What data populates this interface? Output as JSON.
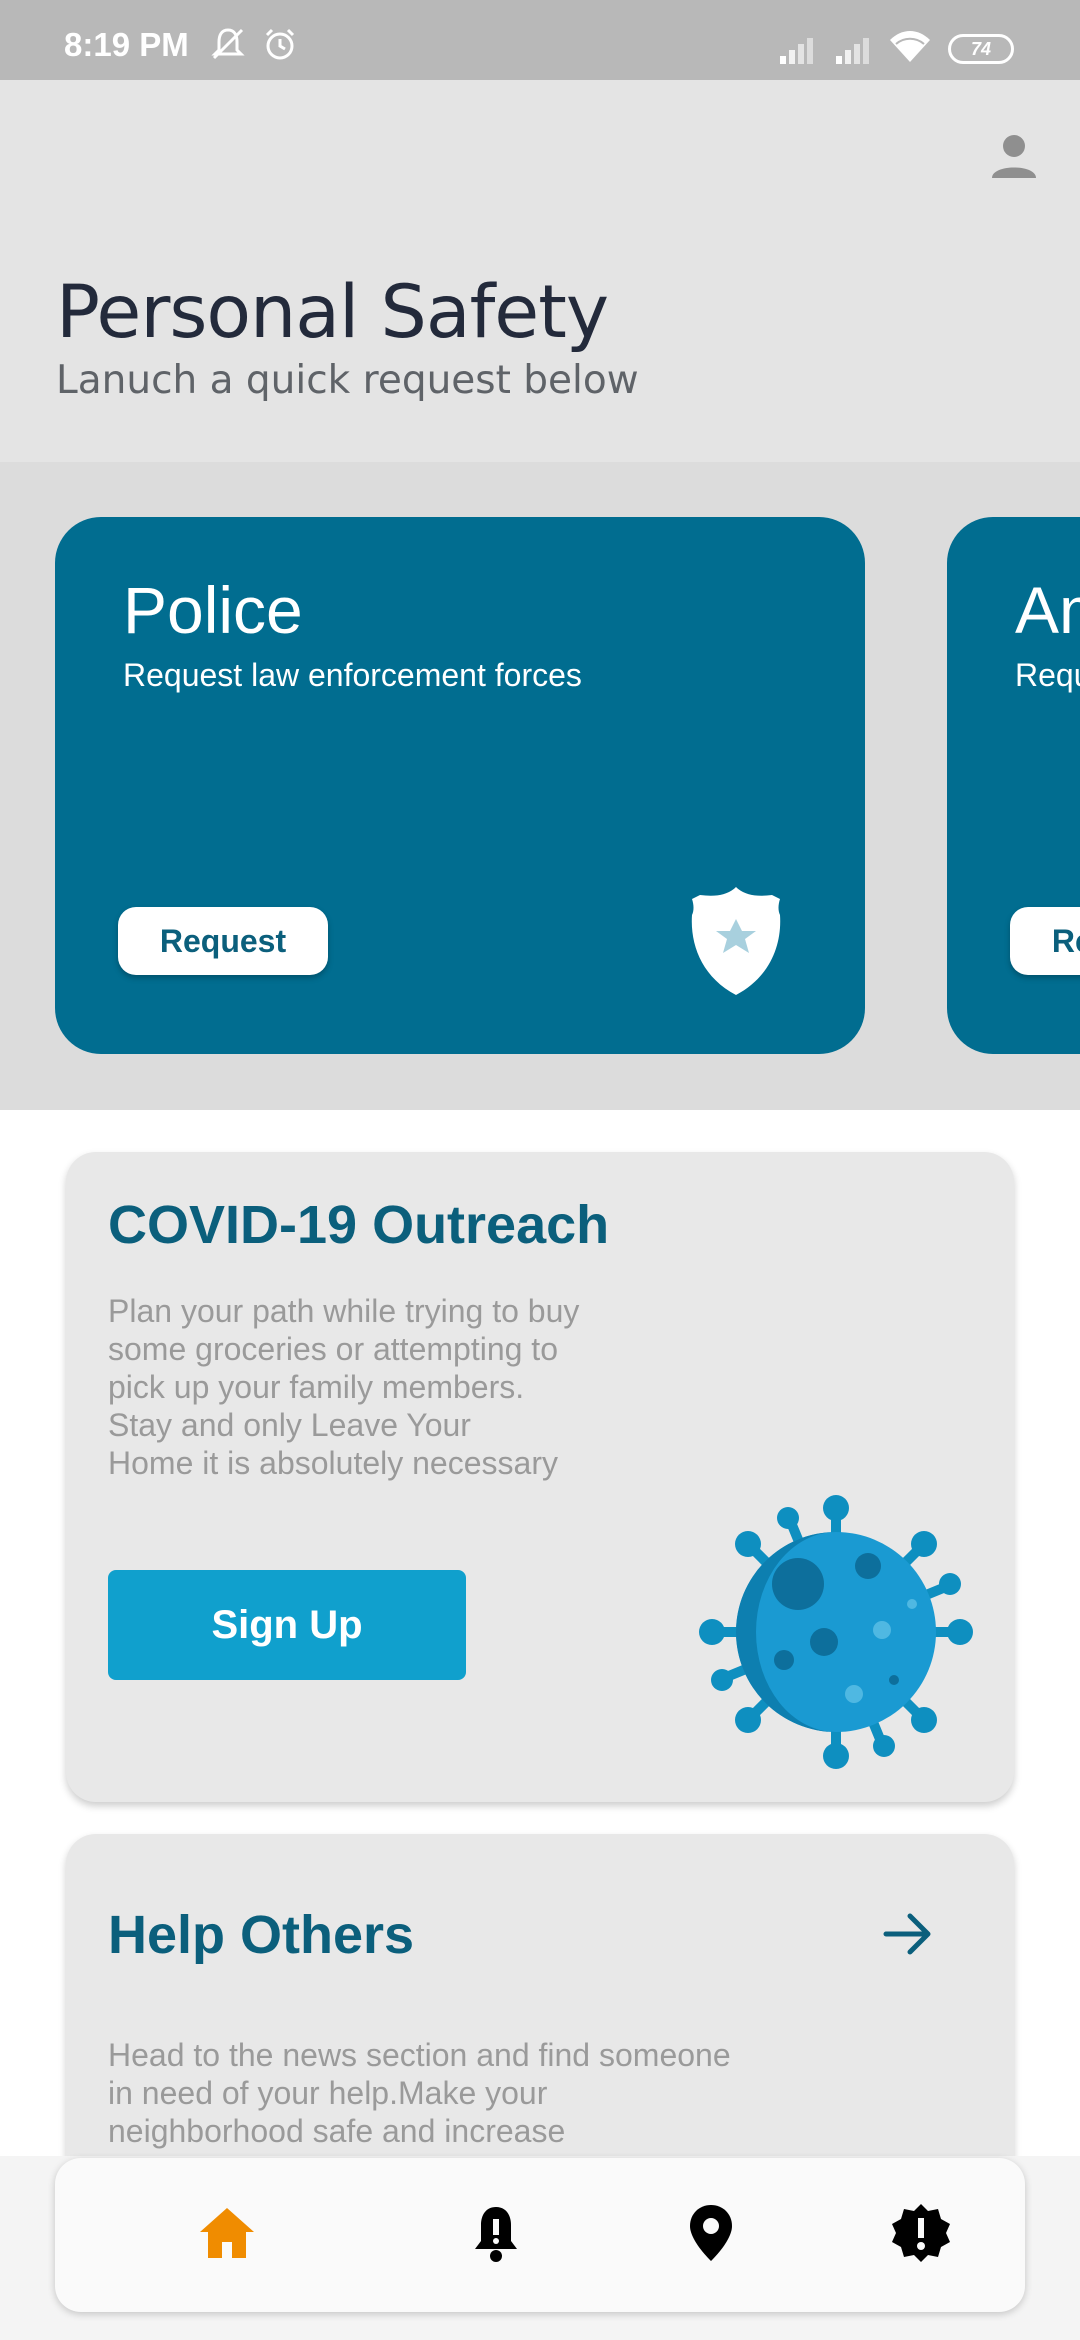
{
  "status_bar": {
    "time": "8:19 PM",
    "battery": "74"
  },
  "header": {
    "title": "Personal Safety",
    "subtitle": "Lanuch a quick request below"
  },
  "services": [
    {
      "title": "Police",
      "description": "Request law enforcement forces",
      "button": "Request",
      "icon": "police-badge-icon"
    },
    {
      "title": "Ambulance",
      "description": "Request medical assistance",
      "button": "Request",
      "icon": "ambulance-icon"
    }
  ],
  "covid": {
    "title": "COVID-19 Outreach",
    "text": "Plan your path while trying to buy\n some groceries or attempting to\n pick up your family members.\n Stay and only Leave Your\n Home it is absolutely necessary",
    "button": "Sign Up",
    "icon": "virus-icon"
  },
  "help": {
    "title": "Help Others",
    "text": "Head to the news section and find someone\nin need of your help.Make your\n neighborhood safe and increase",
    "icon": "arrow-right-icon"
  },
  "nav": {
    "items": [
      "home-icon",
      "bell-icon",
      "location-pin-icon",
      "alert-badge-icon"
    ],
    "active": "home",
    "active_color": "#f08c00"
  },
  "colors": {
    "brand": "#016d90",
    "accent": "#10a0cd",
    "title": "#0b5f7c"
  }
}
